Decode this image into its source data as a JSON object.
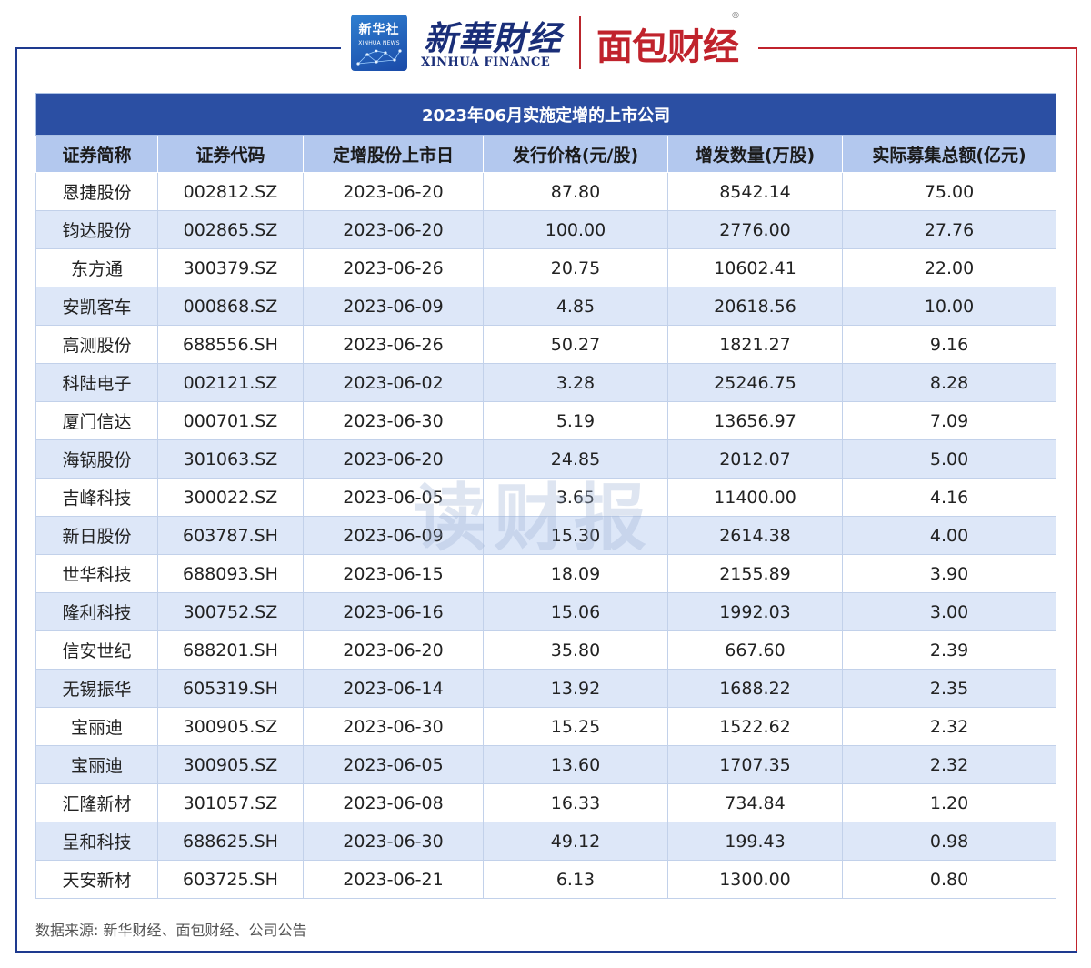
{
  "header": {
    "badge_line1": "新华社",
    "badge_line2": "XINHUA NEWS",
    "xinhua_cn": "新華財经",
    "xinhua_en": "XINHUA FINANCE",
    "mianbao": "面包财经",
    "registered_mark": "®"
  },
  "table": {
    "title": "2023年06月实施定增的上市公司",
    "columns": [
      "证券简称",
      "证券代码",
      "定增股份上市日",
      "发行价格(元/股)",
      "增发数量(万股)",
      "实际募集总额(亿元)"
    ],
    "rows": [
      [
        "恩捷股份",
        "002812.SZ",
        "2023-06-20",
        "87.80",
        "8542.14",
        "75.00"
      ],
      [
        "钧达股份",
        "002865.SZ",
        "2023-06-20",
        "100.00",
        "2776.00",
        "27.76"
      ],
      [
        "东方通",
        "300379.SZ",
        "2023-06-26",
        "20.75",
        "10602.41",
        "22.00"
      ],
      [
        "安凯客车",
        "000868.SZ",
        "2023-06-09",
        "4.85",
        "20618.56",
        "10.00"
      ],
      [
        "高测股份",
        "688556.SH",
        "2023-06-26",
        "50.27",
        "1821.27",
        "9.16"
      ],
      [
        "科陆电子",
        "002121.SZ",
        "2023-06-02",
        "3.28",
        "25246.75",
        "8.28"
      ],
      [
        "厦门信达",
        "000701.SZ",
        "2023-06-30",
        "5.19",
        "13656.97",
        "7.09"
      ],
      [
        "海锅股份",
        "301063.SZ",
        "2023-06-20",
        "24.85",
        "2012.07",
        "5.00"
      ],
      [
        "吉峰科技",
        "300022.SZ",
        "2023-06-05",
        "3.65",
        "11400.00",
        "4.16"
      ],
      [
        "新日股份",
        "603787.SH",
        "2023-06-09",
        "15.30",
        "2614.38",
        "4.00"
      ],
      [
        "世华科技",
        "688093.SH",
        "2023-06-15",
        "18.09",
        "2155.89",
        "3.90"
      ],
      [
        "隆利科技",
        "300752.SZ",
        "2023-06-16",
        "15.06",
        "1992.03",
        "3.00"
      ],
      [
        "信安世纪",
        "688201.SH",
        "2023-06-20",
        "35.80",
        "667.60",
        "2.39"
      ],
      [
        "无锡振华",
        "605319.SH",
        "2023-06-14",
        "13.92",
        "1688.22",
        "2.35"
      ],
      [
        "宝丽迪",
        "300905.SZ",
        "2023-06-30",
        "15.25",
        "1522.62",
        "2.32"
      ],
      [
        "宝丽迪",
        "300905.SZ",
        "2023-06-05",
        "13.60",
        "1707.35",
        "2.32"
      ],
      [
        "汇隆新材",
        "301057.SZ",
        "2023-06-08",
        "16.33",
        "734.84",
        "1.20"
      ],
      [
        "呈和科技",
        "688625.SH",
        "2023-06-30",
        "49.12",
        "199.43",
        "0.98"
      ],
      [
        "天安新材",
        "603725.SH",
        "2023-06-21",
        "6.13",
        "1300.00",
        "0.80"
      ]
    ]
  },
  "watermark": "读财报",
  "source": "数据来源: 新华财经、面包财经、公司公告",
  "colors": {
    "title_bg": "#2b4fa3",
    "header_bg": "#b3c8ee",
    "stripe_bg": "#dde7f8",
    "frame_blue": "#1e3a8f",
    "frame_red": "#c0232c"
  }
}
